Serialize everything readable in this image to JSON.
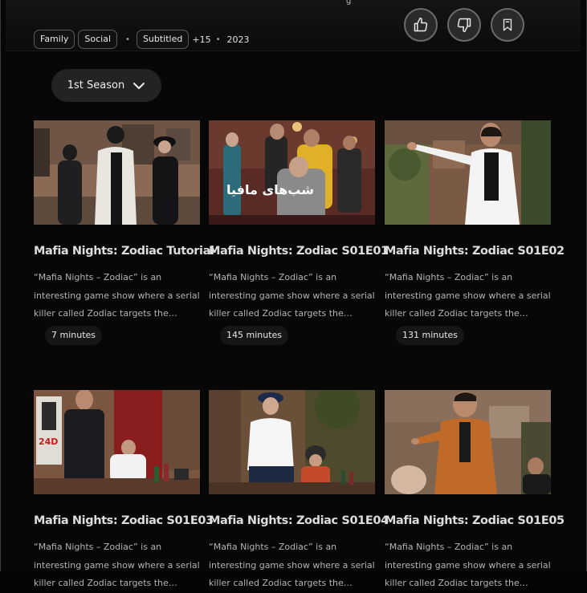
{
  "hero": {
    "tail_text": "g"
  },
  "tags": {
    "genres": [
      "Family",
      "Social"
    ],
    "subtitled": "Subtitled",
    "age": "+15",
    "year": "2023"
  },
  "actions": {
    "like_icon": "thumbs-up-icon",
    "dislike_icon": "thumbs-down-icon",
    "bookmark_icon": "bookmark-icon"
  },
  "season": {
    "label": "1st Season",
    "icon": "chevron-down-icon"
  },
  "episodes": [
    {
      "title": "Mafia Nights: Zodiac Tutorial",
      "description": "“Mafia Nights – Zodiac” is an interesting game show where a serial killer called Zodiac targets the citizens and the…",
      "duration": "7 minutes"
    },
    {
      "title": "Mafia Nights: Zodiac S01E01",
      "description": "“Mafia Nights – Zodiac” is an interesting game show where a serial killer called Zodiac targets the citizens and the…",
      "duration": "145 minutes",
      "poster_text": "شب‌های مافیا"
    },
    {
      "title": "Mafia Nights: Zodiac S01E02",
      "description": "“Mafia Nights – Zodiac” is an interesting game show where a serial killer called Zodiac targets the citizens and the…",
      "duration": "131 minutes"
    },
    {
      "title": "Mafia Nights: Zodiac S01E03",
      "description": "“Mafia Nights – Zodiac” is an interesting game show where a serial killer called Zodiac targets the citizens and the…",
      "poster_text": "24D"
    },
    {
      "title": "Mafia Nights: Zodiac S01E04",
      "description": "“Mafia Nights – Zodiac” is an interesting game show where a serial killer called Zodiac targets the citizens and the…"
    },
    {
      "title": "Mafia Nights: Zodiac S01E05",
      "description": "“Mafia Nights – Zodiac” is an interesting game show where a serial killer called Zodiac targets the citizens and the…"
    }
  ]
}
